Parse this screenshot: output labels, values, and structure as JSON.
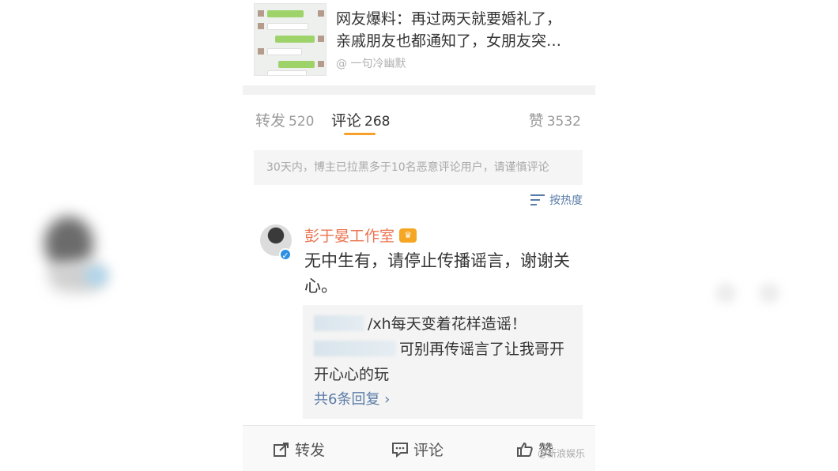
{
  "post": {
    "headline_line1": "网友爆料：再过两天就要婚礼了，",
    "headline_line2": "亲戚朋友也都通知了，女朋友突…",
    "author": "@ 一句冷幽默"
  },
  "tabs": [
    {
      "label": "转发",
      "count": "520"
    },
    {
      "label": "评论",
      "count": "268"
    },
    {
      "label": "赞",
      "count": "3532"
    }
  ],
  "notice": "30天内，博主已拉黑多于10名恶意评论用户，请谨慎评论",
  "sort_label": "按热度",
  "comment": {
    "name": "彭于晏工作室",
    "text": "无中生有，请停止传播谣言，谢谢关心。",
    "replies": [
      {
        "text": "/xh每天变着花样造谣！"
      },
      {
        "text": "可别再传谣言了让我哥开开心心的玩"
      }
    ],
    "more": "共6条回复 ›"
  },
  "actions": {
    "repost": "转发",
    "comment": "评论",
    "like": "赞"
  },
  "watermark": "@新浪娱乐",
  "colors": {
    "accent_orange": "#f7a12a",
    "name_orange": "#eb7350",
    "link_blue": "#5a7ca8",
    "verify_blue": "#2d8fe4"
  }
}
